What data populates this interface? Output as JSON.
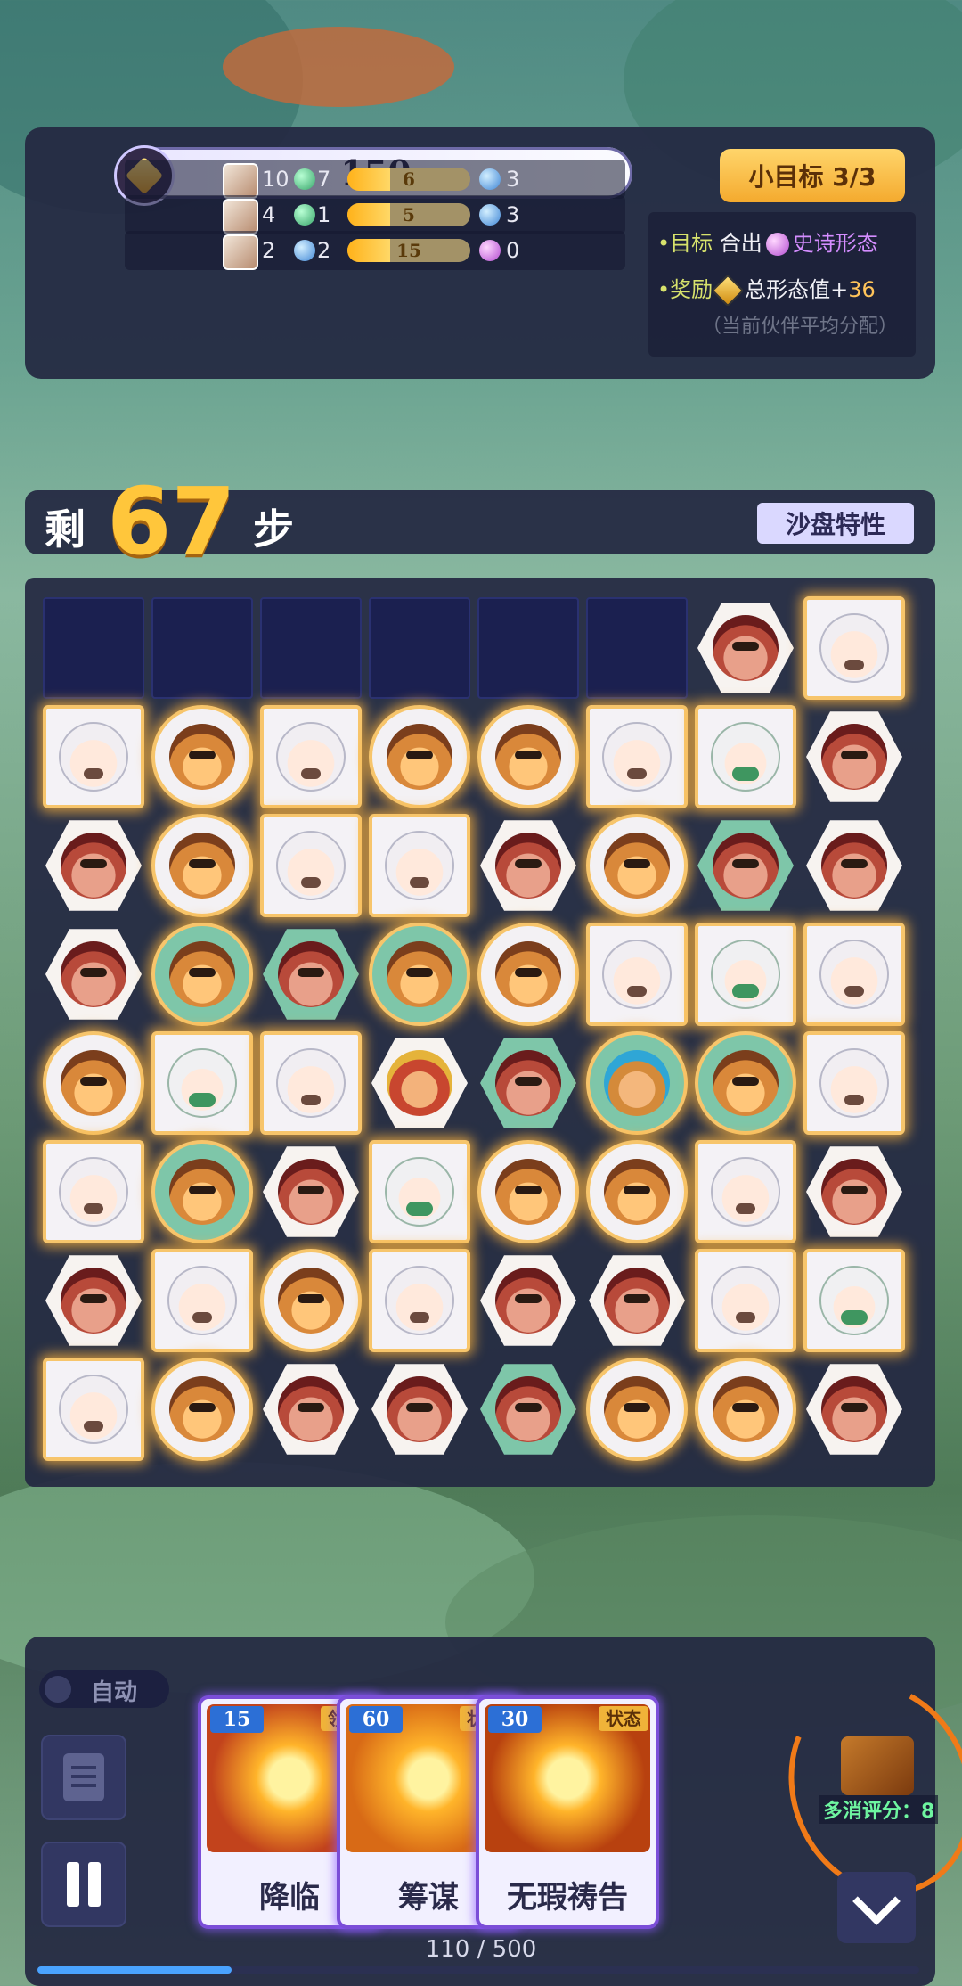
{
  "score": "150",
  "small_goal": "小目标 3/3",
  "partners": [
    {
      "count": "10",
      "orb1": "green",
      "orb1_count": "7",
      "level": "6",
      "progress": 0.35,
      "orb2": "blue",
      "orb2_count": "3"
    },
    {
      "count": "4",
      "orb1": "green",
      "orb1_count": "1",
      "level": "5",
      "progress": 0.35,
      "orb2": "blue",
      "orb2_count": "3"
    },
    {
      "count": "2",
      "orb1": "blue",
      "orb1_count": "2",
      "level": "15",
      "progress": 0.35,
      "orb2": "purple",
      "orb2_count": "0"
    }
  ],
  "goal": {
    "target_label": "•目标",
    "target_text": "合出",
    "target_form": "史诗形态",
    "reward_label": "•奖励",
    "reward_text": "总形态值+",
    "reward_value": "36",
    "note": "（当前伙伴平均分配）"
  },
  "steps": {
    "prefix": "剩",
    "value": "67",
    "suffix": "步"
  },
  "sandbox_traits": "沙盘特性",
  "board": [
    [
      "empty",
      "empty",
      "empty",
      "empty",
      "empty",
      "empty",
      "hex-red",
      "square-white"
    ],
    [
      "square-white",
      "circle-orange",
      "square-white",
      "circle-orange",
      "circle-orange",
      "square-white",
      "square-sage",
      "hex-red"
    ],
    [
      "hex-red",
      "circle-orange",
      "square-white",
      "square-white",
      "hex-red",
      "circle-orange",
      "hexgreen-red",
      "hex-red"
    ],
    [
      "hex-red",
      "circlegreen-orange",
      "hexgreen-red",
      "circlegreen-orange",
      "circle-orange",
      "square-white",
      "square-sage",
      "square-white"
    ],
    [
      "circle-orange",
      "square-sage",
      "square-white",
      "hex-special",
      "hexgreen-red",
      "circlegreen-special2",
      "circlegreen-orange",
      "square-white"
    ],
    [
      "square-white",
      "circlegreen-orange",
      "hex-red",
      "square-sage",
      "circle-orange",
      "circle-orange",
      "square-white",
      "hex-red"
    ],
    [
      "hex-red",
      "square-white",
      "circle-orange",
      "square-white",
      "hex-red",
      "hex-red",
      "square-white",
      "square-sage"
    ],
    [
      "square-white",
      "circle-orange",
      "hex-red",
      "hex-red",
      "hexgreen-red",
      "circle-orange",
      "circle-orange",
      "hex-red"
    ]
  ],
  "auto_label": "自动",
  "skills": [
    {
      "cost": "15",
      "type": "领域",
      "name": "降临",
      "art": "#c2431c"
    },
    {
      "cost": "60",
      "type": "状态",
      "name": "筹谋",
      "art": "#d86a16"
    },
    {
      "cost": "30",
      "type": "状态",
      "name": "无瑕祷告",
      "art": "#b8410f"
    }
  ],
  "multi_score": "多消评分：8",
  "energy": {
    "text": "110 / 500",
    "fraction": 0.22
  },
  "colors": {
    "accent": "#ffc63b",
    "panel": "#242842",
    "skill_border": "#7b4ed8"
  }
}
